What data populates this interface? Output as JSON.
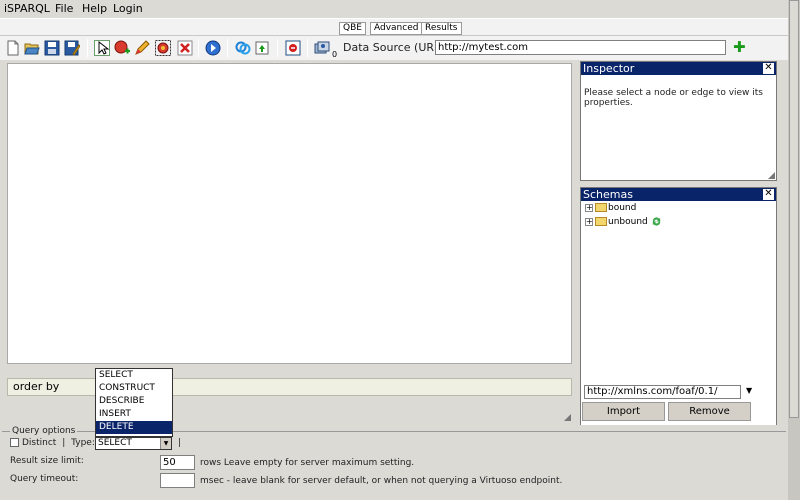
{
  "menu": [
    "iSPARQL",
    "File",
    "Help",
    "Login"
  ],
  "tabs": [
    "QBE",
    "Advanced",
    "Results"
  ],
  "toolbar": {
    "data_source_label": "Data Source (URL)",
    "data_source_value": "http://mytest.com",
    "icons": [
      "new-icon",
      "open-icon",
      "save-icon",
      "save-as-icon",
      "pointer-icon",
      "add-node-icon",
      "edit-icon",
      "add-group-icon",
      "delete-icon",
      "run-icon",
      "link-icon",
      "load-icon",
      "clear-icon",
      "datasets-icon"
    ],
    "dataset_count": "0"
  },
  "inspector": {
    "title": "Inspector",
    "message": "Please select a node or edge to view its properties."
  },
  "schemas": {
    "title": "Schemas",
    "items": [
      "bound",
      "unbound"
    ],
    "input_value": "http://xmlns.com/foaf/0.1/",
    "import_label": "Import",
    "remove_label": "Remove"
  },
  "order_by": "order by",
  "query_options": {
    "legend": "Query options",
    "distinct_label": "Distinct",
    "sep": "|",
    "type_label": "Type:",
    "type_value": "SELECT",
    "type_options": [
      "SELECT",
      "CONSTRUCT",
      "DESCRIBE",
      "INSERT",
      "DELETE"
    ],
    "type_highlighted": "DELETE",
    "result_limit_label": "Result size limit:",
    "result_limit_value": "50",
    "result_limit_hint": "rows Leave empty for server maximum setting.",
    "timeout_label": "Query timeout:",
    "timeout_value": "",
    "timeout_hint": "msec - leave blank for server default, or when not querying a Virtuoso endpoint."
  }
}
